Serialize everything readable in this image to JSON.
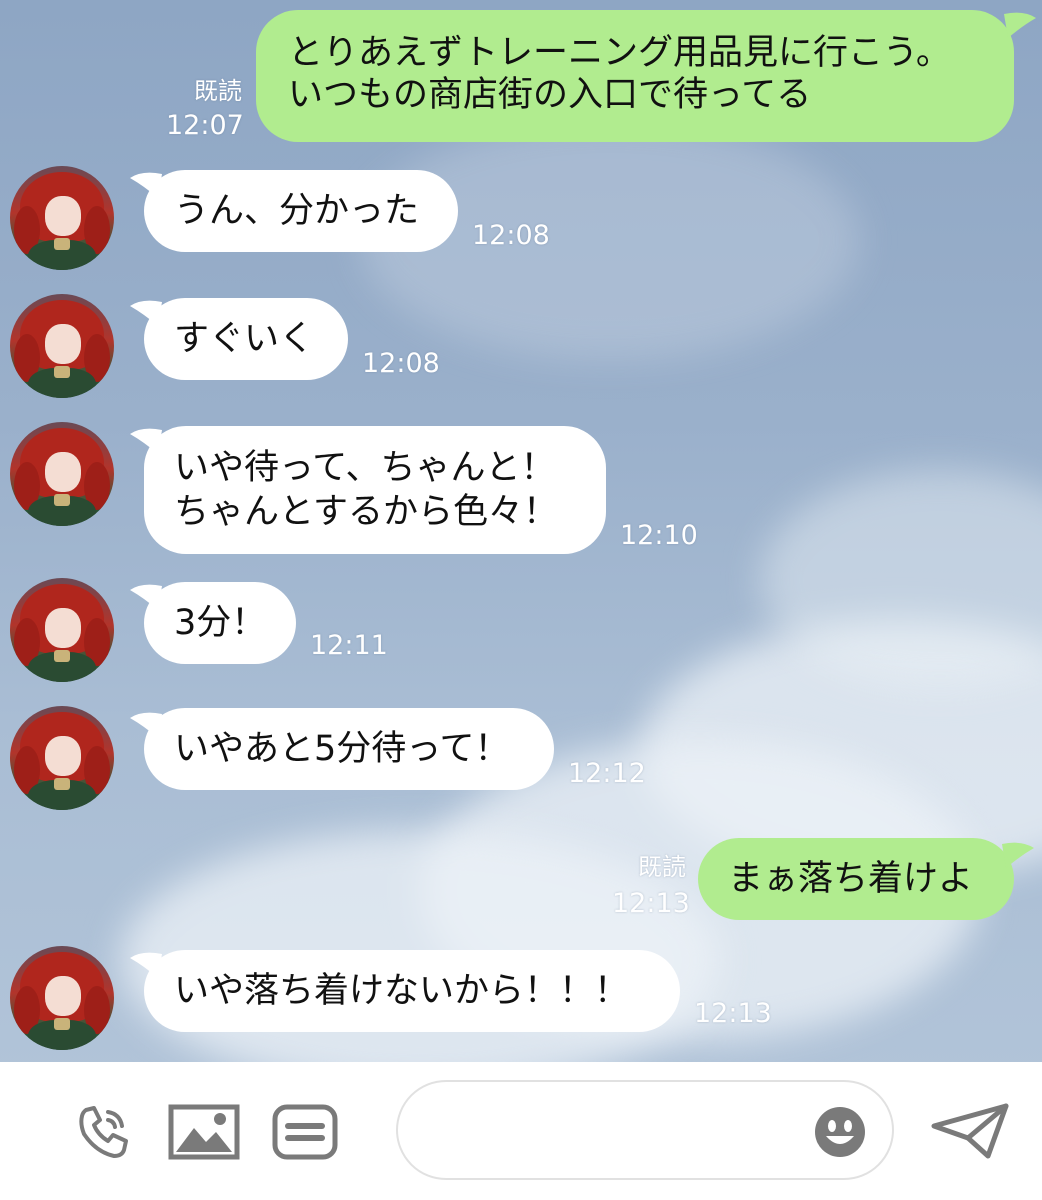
{
  "messages": [
    {
      "side": "out",
      "lines": [
        "とりあえずトレーニング用品見に行こう。",
        "いつもの商店街の入口で待ってる"
      ],
      "read": "既読",
      "time": "12:07"
    },
    {
      "side": "in",
      "lines": [
        "うん、分かった"
      ],
      "time": "12:08"
    },
    {
      "side": "in",
      "lines": [
        "すぐいく"
      ],
      "time": "12:08"
    },
    {
      "side": "in",
      "lines": [
        "いや待って、ちゃんと！",
        "ちゃんとするから色々！"
      ],
      "time": "12:10"
    },
    {
      "side": "in",
      "lines": [
        "3分！"
      ],
      "time": "12:11"
    },
    {
      "side": "in",
      "lines": [
        "いやあと5分待って！"
      ],
      "time": "12:12"
    },
    {
      "side": "out",
      "lines": [
        "まぁ落ち着けよ"
      ],
      "read": "既読",
      "time": "12:13"
    },
    {
      "side": "in",
      "lines": [
        "いや落ち着けないから！！！"
      ],
      "time": "12:13"
    }
  ],
  "input": {
    "placeholder": ""
  },
  "icons": {
    "call": "phone-icon",
    "image": "image-icon",
    "keyboard": "keyboard-icon",
    "emoji": "emoji-icon",
    "send": "send-icon"
  },
  "colors": {
    "outgoing_bubble": "#b1ec8f",
    "incoming_bubble": "#ffffff",
    "icon_gray": "#7a7a7a"
  }
}
